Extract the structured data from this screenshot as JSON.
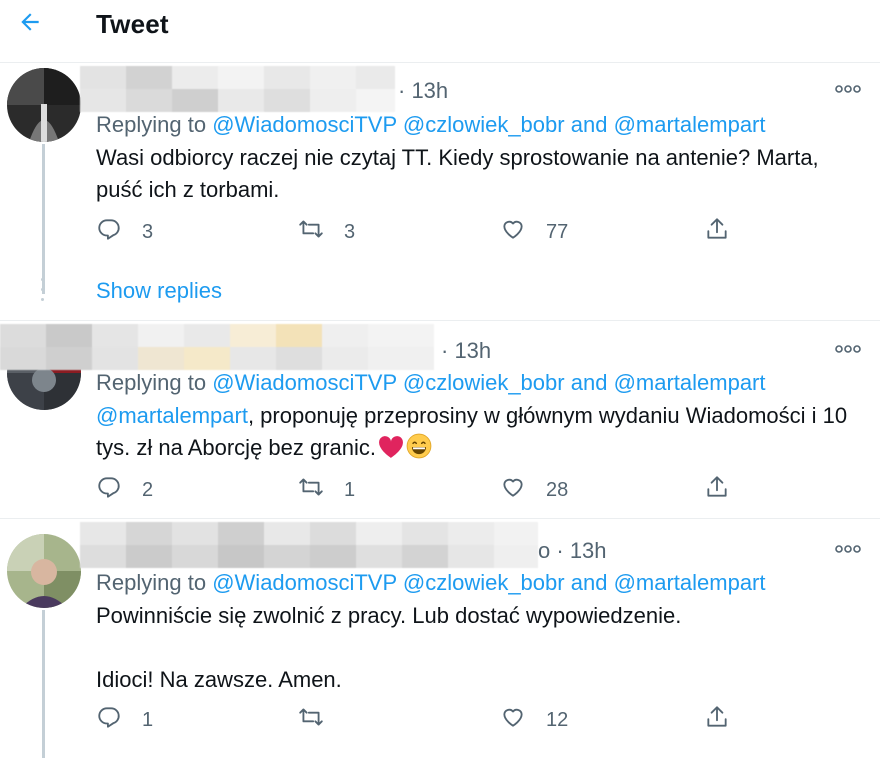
{
  "header": {
    "title": "Tweet",
    "back_icon": "arrow-left-icon"
  },
  "colors": {
    "accent": "#1d9bf0",
    "secondary_text": "#536471",
    "heart_red": "#e0245e"
  },
  "tweets": [
    {
      "time": "· 13h",
      "replying_prefix": "Replying to",
      "mentions": [
        "@WiadomosciTVP",
        "@czlowiek_bobr",
        "and",
        "@martalempart"
      ],
      "text": "Wasi odbiorcy raczej nie czytaj TT. Kiedy sprostowanie na antenie? Marta, puść ich z torbami.",
      "replies": "3",
      "retweets": "3",
      "likes": "77"
    },
    {
      "time": "· 13h",
      "replying_prefix": "Replying to",
      "mentions": [
        "@WiadomosciTVP",
        "@czlowiek_bobr",
        "and",
        "@martalempart"
      ],
      "text_mention": "@martalempart",
      "text": ", proponuję przeprosiny w głównym wydaniu Wiadomości i 10 tys. zł na Aborcję bez granic.",
      "emoji": "😁",
      "replies": "2",
      "retweets": "1",
      "likes": "28"
    },
    {
      "time_prefix": "o",
      "time": "· 13h",
      "replying_prefix": "Replying to",
      "mentions": [
        "@WiadomosciTVP",
        "@czlowiek_bobr",
        "and",
        "@martalempart"
      ],
      "text": "Powinniście się zwolnić z pracy. Lub dostać wypowiedzenie.\n\nIdioci! Na zawsze. Amen.",
      "replies": "1",
      "retweets": "",
      "likes": "12"
    }
  ],
  "show_replies": "Show replies"
}
